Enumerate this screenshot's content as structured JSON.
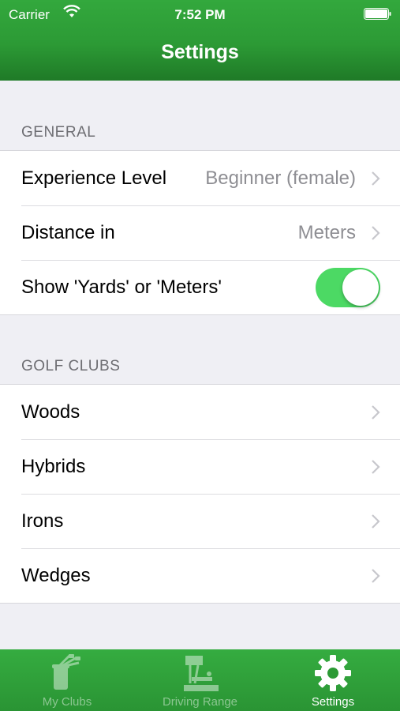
{
  "status_bar": {
    "carrier": "Carrier",
    "time": "7:52 PM"
  },
  "nav": {
    "title": "Settings"
  },
  "sections": {
    "general": {
      "header": "GENERAL",
      "experience": {
        "label": "Experience Level",
        "value": "Beginner (female)"
      },
      "distance": {
        "label": "Distance in",
        "value": "Meters"
      },
      "show_units": {
        "label": "Show 'Yards' or 'Meters'",
        "toggle_on": true
      }
    },
    "golf_clubs": {
      "header": "GOLF CLUBS",
      "items": [
        {
          "label": "Woods"
        },
        {
          "label": "Hybrids"
        },
        {
          "label": "Irons"
        },
        {
          "label": "Wedges"
        }
      ]
    }
  },
  "tab_bar": {
    "tabs": [
      {
        "label": "My Clubs",
        "icon": "golf-bag-icon",
        "active": false
      },
      {
        "label": "Driving Range",
        "icon": "driving-range-icon",
        "active": false
      },
      {
        "label": "Settings",
        "icon": "gear-icon",
        "active": true
      }
    ]
  },
  "colors": {
    "nav_green": "#2c9a35",
    "toggle_green": "#4cd964",
    "background": "#efeff4"
  }
}
